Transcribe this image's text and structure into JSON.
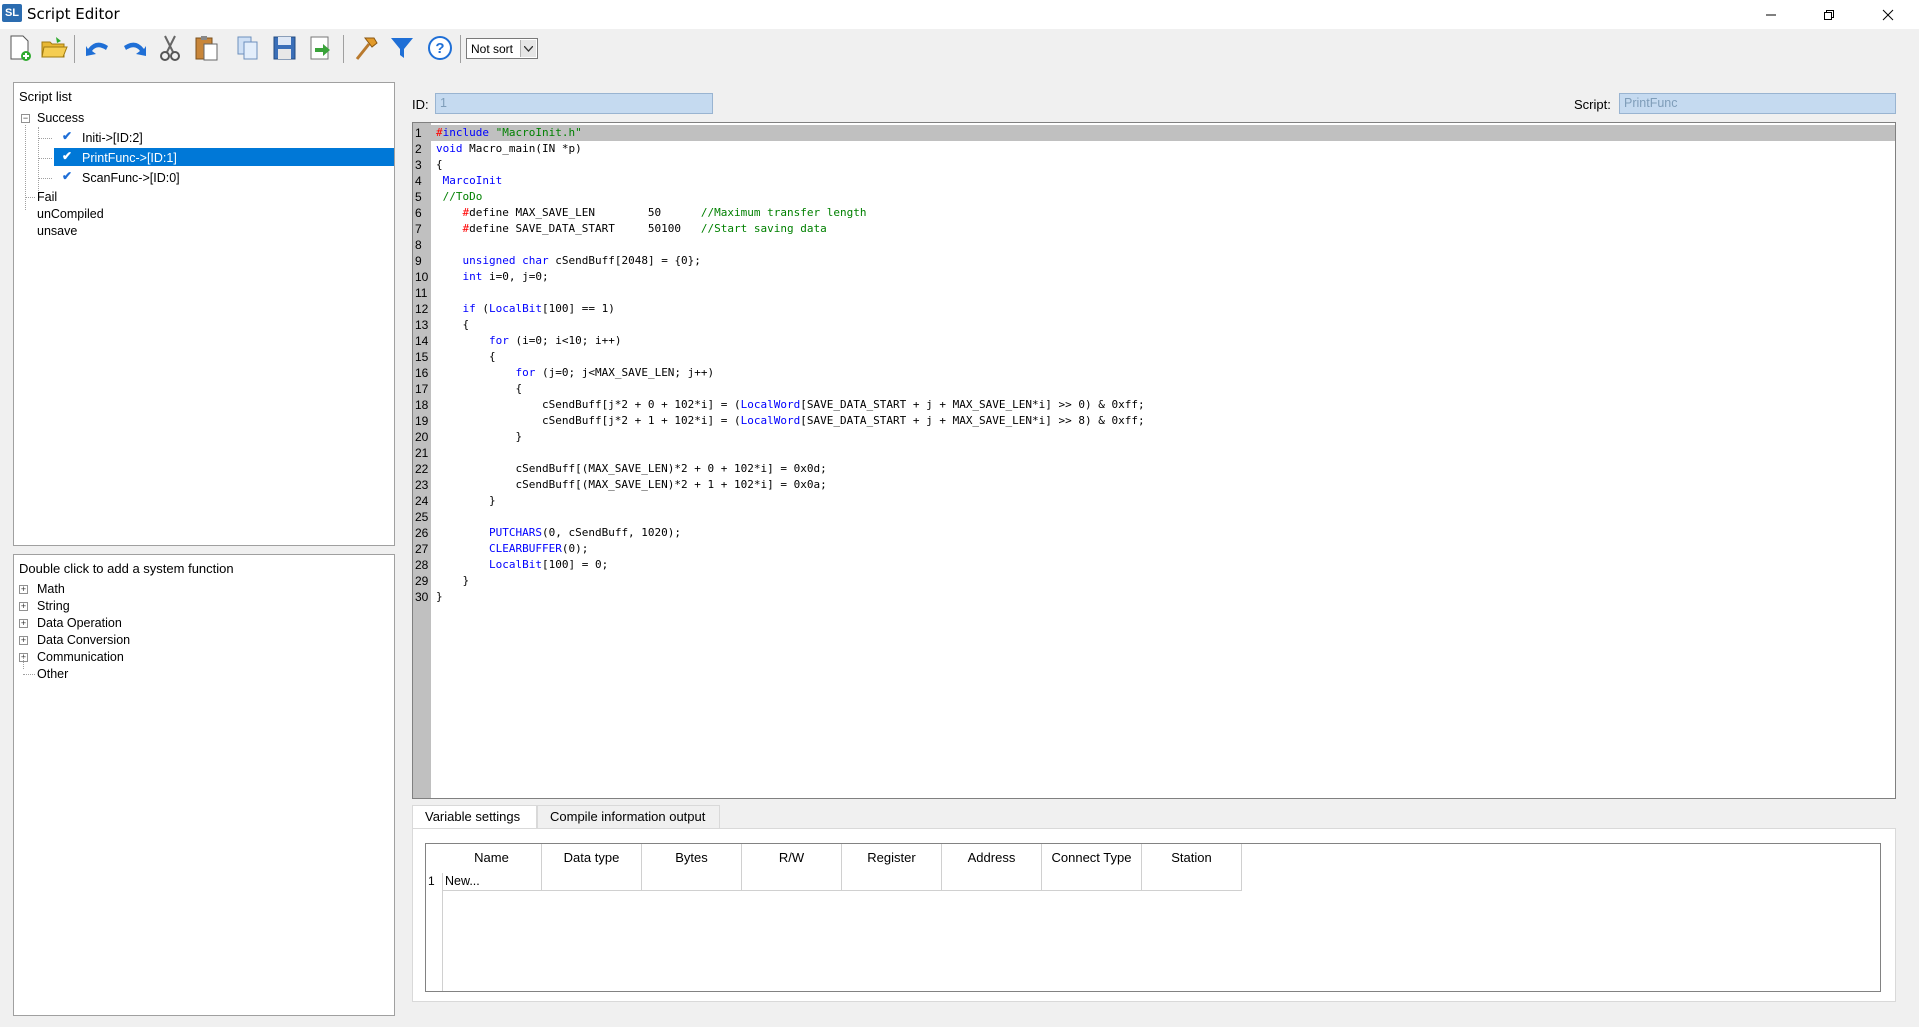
{
  "window": {
    "app_icon": "SL",
    "title": "Script Editor",
    "minimize_icon": "minimize-icon",
    "maximize_icon": "restore-icon",
    "close_icon": "close-icon"
  },
  "toolbar": {
    "buttons": [
      "new-file-icon",
      "open-folder-icon",
      "undo-icon",
      "redo-icon",
      "cut-icon",
      "paste-icon",
      "copy-icon",
      "save-icon",
      "export-icon",
      "compile-hammer-icon",
      "filter-icon",
      "help-icon"
    ],
    "sort_value": "Not sort"
  },
  "script_list": {
    "title": "Script list",
    "groups": [
      {
        "label": "Success",
        "expanded": true,
        "items": [
          {
            "label": "Initi->[ID:2]",
            "checked": true,
            "selected": false
          },
          {
            "label": "PrintFunc->[ID:1]",
            "checked": true,
            "selected": true
          },
          {
            "label": "ScanFunc->[ID:0]",
            "checked": true,
            "selected": false
          }
        ]
      },
      {
        "label": "Fail"
      },
      {
        "label": "unCompiled"
      },
      {
        "label": "unsave"
      }
    ]
  },
  "system_functions": {
    "title": "Double click to add a system function",
    "items": [
      {
        "label": "Math",
        "expandable": true
      },
      {
        "label": "String",
        "expandable": true
      },
      {
        "label": "Data Operation",
        "expandable": true
      },
      {
        "label": "Data Conversion",
        "expandable": true
      },
      {
        "label": "Communication",
        "expandable": true
      },
      {
        "label": "Other",
        "expandable": false
      }
    ]
  },
  "id_field": {
    "label": "ID:",
    "value": "1"
  },
  "script_field": {
    "label": "Script:",
    "value": "PrintFunc"
  },
  "code_lines": [
    "#include \"MacroInit.h\"",
    "void Macro_main(IN *p)",
    "{",
    " MarcoInit",
    " //ToDo",
    "    #define MAX_SAVE_LEN        50      //Maximum transfer length",
    "    #define SAVE_DATA_START     50100   //Start saving data",
    "",
    "    unsigned char cSendBuff[2048] = {0};",
    "    int i=0, j=0;",
    "",
    "    if (LocalBit[100] == 1)",
    "    {",
    "        for (i=0; i<10; i++)",
    "        {",
    "            for (j=0; j<MAX_SAVE_LEN; j++)",
    "            {",
    "                cSendBuff[j*2 + 0 + 102*i] = (LocalWord[SAVE_DATA_START + j + MAX_SAVE_LEN*i] >> 0) & 0xff;",
    "                cSendBuff[j*2 + 1 + 102*i] = (LocalWord[SAVE_DATA_START + j + MAX_SAVE_LEN*i] >> 8) & 0xff;",
    "            }",
    "",
    "            cSendBuff[(MAX_SAVE_LEN)*2 + 0 + 102*i] = 0x0d;",
    "            cSendBuff[(MAX_SAVE_LEN)*2 + 1 + 102*i] = 0x0a;",
    "        }",
    "",
    "        PUTCHARS(0, cSendBuff, 1020);",
    "        CLEARBUFFER(0);",
    "        LocalBit[100] = 0;",
    "    }",
    "}"
  ],
  "tabs": [
    {
      "label": "Variable settings",
      "active": true
    },
    {
      "label": "Compile information output",
      "active": false
    }
  ],
  "variables_table": {
    "columns": [
      "Name",
      "Data type",
      "Bytes",
      "R/W",
      "Register",
      "Address",
      "Connect Type",
      "Station"
    ],
    "rows": [
      {
        "num": "1",
        "name": "New..."
      }
    ]
  }
}
